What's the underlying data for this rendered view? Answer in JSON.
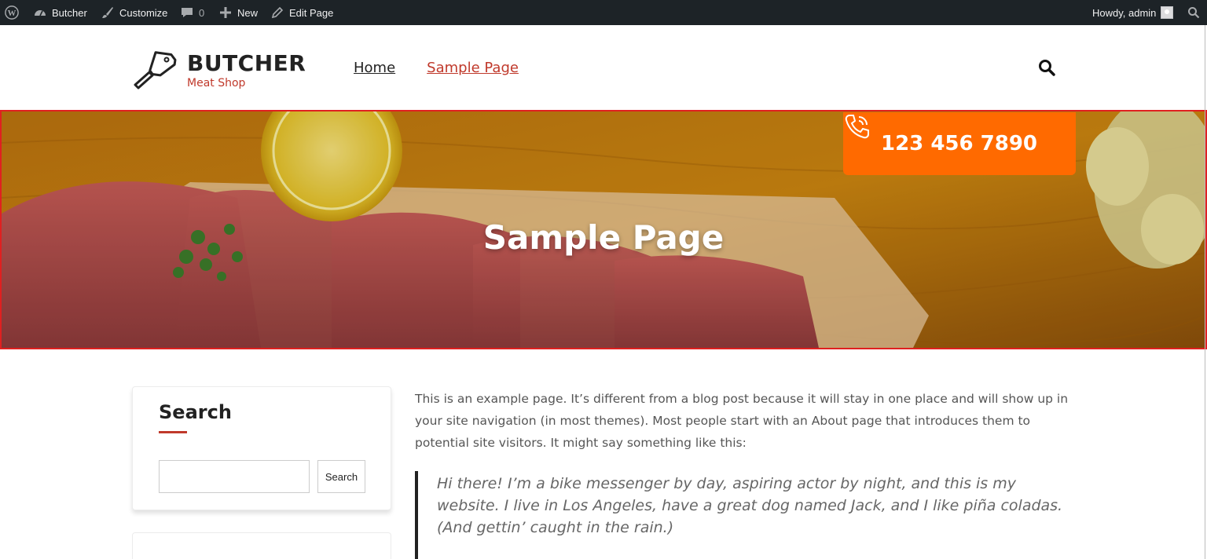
{
  "admin_bar": {
    "site_name": "Butcher",
    "customize": "Customize",
    "comments_count": "0",
    "new": "New",
    "edit_page": "Edit Page",
    "howdy": "Howdy, admin"
  },
  "header": {
    "logo_title": "BUTCHER",
    "logo_subtitle": "Meat Shop",
    "nav": {
      "home": "Home",
      "sample": "Sample Page"
    }
  },
  "hero": {
    "title": "Sample Page",
    "phone": "123 456 7890"
  },
  "sidebar": {
    "search_title": "Search",
    "search_button": "Search",
    "search_value": ""
  },
  "content": {
    "paragraph": "This is an example page. It’s different from a blog post because it will stay in one place and will show up in your site navigation (in most themes). Most people start with an About page that introduces them to potential site visitors. It might say something like this:",
    "quote": "Hi there! I’m a bike messenger by day, aspiring actor by night, and this is my website. I live in Los Angeles, have a great dog named Jack, and I like piña coladas. (And gettin’ caught in the rain.)"
  },
  "colors": {
    "accent_red": "#c0392b",
    "phone_orange": "#ff6a00",
    "admin_bar": "#1d2327"
  }
}
